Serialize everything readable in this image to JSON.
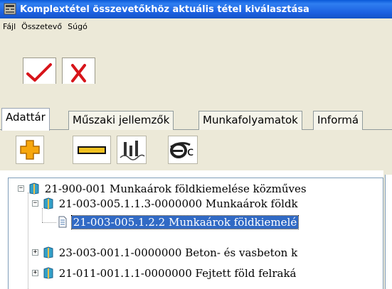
{
  "window": {
    "title": "Komplextétel összevetőkhöz aktuális tétel kiválasztása"
  },
  "menu": {
    "items": [
      "Fájl",
      "Összetevő",
      "Súgó"
    ]
  },
  "toolbar": {
    "ok_icon": "checkmark-icon",
    "cancel_icon": "red-x-icon"
  },
  "tabs": [
    "Adattár",
    "Műszaki jellemzők",
    "Munkafolyamatok",
    "Informá"
  ],
  "subtoolbar": {
    "ec_label": "c"
  },
  "tree": [
    {
      "label": "21-900-001 Munkaárok földkiemelése közműves",
      "expander": "−"
    },
    {
      "label": "21-003-005.1.1.3-0000000 Munkaárok földk",
      "expander": "−"
    },
    {
      "label": "21-003-005.1.2.2 Munkaárok földkiemelé",
      "expander": ""
    },
    {
      "label": "23-003-001.1-0000000 Beton- és vasbeton k",
      "expander": "+"
    },
    {
      "label": "21-011-001.1.1-0000000 Fejtett föld felraká",
      "expander": "+"
    }
  ]
}
